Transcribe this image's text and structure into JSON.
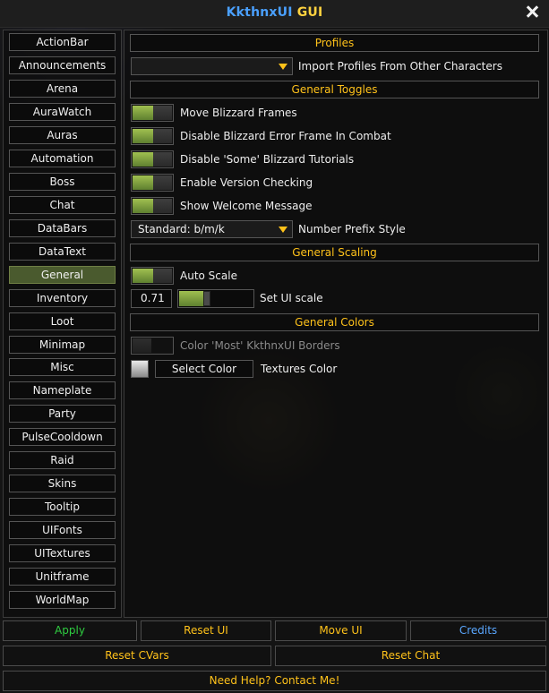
{
  "window": {
    "title_part1": "KkthnxUI",
    "title_part2": "GUI"
  },
  "sidebar": {
    "active": "General",
    "items": [
      "ActionBar",
      "Announcements",
      "Arena",
      "AuraWatch",
      "Auras",
      "Automation",
      "Boss",
      "Chat",
      "DataBars",
      "DataText",
      "General",
      "Inventory",
      "Loot",
      "Minimap",
      "Misc",
      "Nameplate",
      "Party",
      "PulseCooldown",
      "Raid",
      "Skins",
      "Tooltip",
      "UIFonts",
      "UITextures",
      "Unitframe",
      "WorldMap"
    ]
  },
  "main": {
    "profiles_header": "Profiles",
    "import_profiles_value": "",
    "import_profiles_label": "Import Profiles From Other Characters",
    "general_toggles_header": "General Toggles",
    "toggles": [
      {
        "label": "Move Blizzard Frames",
        "enabled": true
      },
      {
        "label": "Disable Blizzard Error Frame In Combat",
        "enabled": true
      },
      {
        "label": "Disable 'Some' Blizzard Tutorials",
        "enabled": true
      },
      {
        "label": "Enable Version Checking",
        "enabled": true
      },
      {
        "label": "Show Welcome Message",
        "enabled": true
      }
    ],
    "number_prefix_value": "Standard: b/m/k",
    "number_prefix_label": "Number Prefix Style",
    "general_scaling_header": "General Scaling",
    "auto_scale_label": "Auto Scale",
    "auto_scale_enabled": true,
    "ui_scale_value": "0.71",
    "ui_scale_fraction": 0.36,
    "ui_scale_label": "Set UI scale",
    "general_colors_header": "General Colors",
    "color_borders_label": "Color 'Most' KkthnxUI Borders",
    "color_borders_enabled": false,
    "select_color_label": "Select Color",
    "textures_color_label": "Textures Color"
  },
  "footer": {
    "apply": "Apply",
    "reset_ui": "Reset UI",
    "move_ui": "Move UI",
    "credits": "Credits",
    "reset_cvars": "Reset CVars",
    "reset_chat": "Reset Chat",
    "help": "Need Help? Contact Me!"
  },
  "colors": {
    "accent_gold": "#ffc21a",
    "title_blue": "#4aa0ff",
    "apply_green": "#2ecc40",
    "credits_blue": "#5aa7ff",
    "toggle_on": "#8fb046"
  }
}
